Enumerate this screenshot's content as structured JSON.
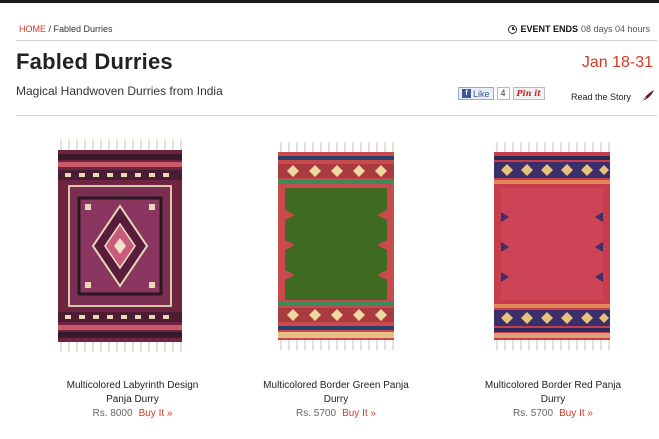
{
  "breadcrumb": {
    "home": "HOME",
    "separator": " / ",
    "current": "Fabled Durries"
  },
  "event": {
    "label": "EVENT ENDS",
    "remaining": "08 days 04 hours",
    "icon": "clock-icon"
  },
  "page": {
    "title": "Fabled Durries",
    "dates": "Jan 18-31",
    "subtitle": "Magical Handwoven Durries from India"
  },
  "social": {
    "like_label": "Like",
    "like_count": "4",
    "pin_label": "Pin it",
    "story_label": "Read the Story",
    "story_icon": "quill-icon"
  },
  "colors": {
    "accent": "#d33a25"
  },
  "products": [
    {
      "name_line1": "Multicolored Labyrinth Design",
      "name_line2": "Panja Durry",
      "price": "Rs. 8000",
      "buy": "Buy It »"
    },
    {
      "name_line1": "Multicolored Border Green Panja",
      "name_line2": "Durry",
      "price": "Rs. 5700",
      "buy": "Buy It »"
    },
    {
      "name_line1": "Multicolored Border Red Panja",
      "name_line2": "Durry",
      "price": "Rs. 5700",
      "buy": "Buy It »"
    }
  ]
}
